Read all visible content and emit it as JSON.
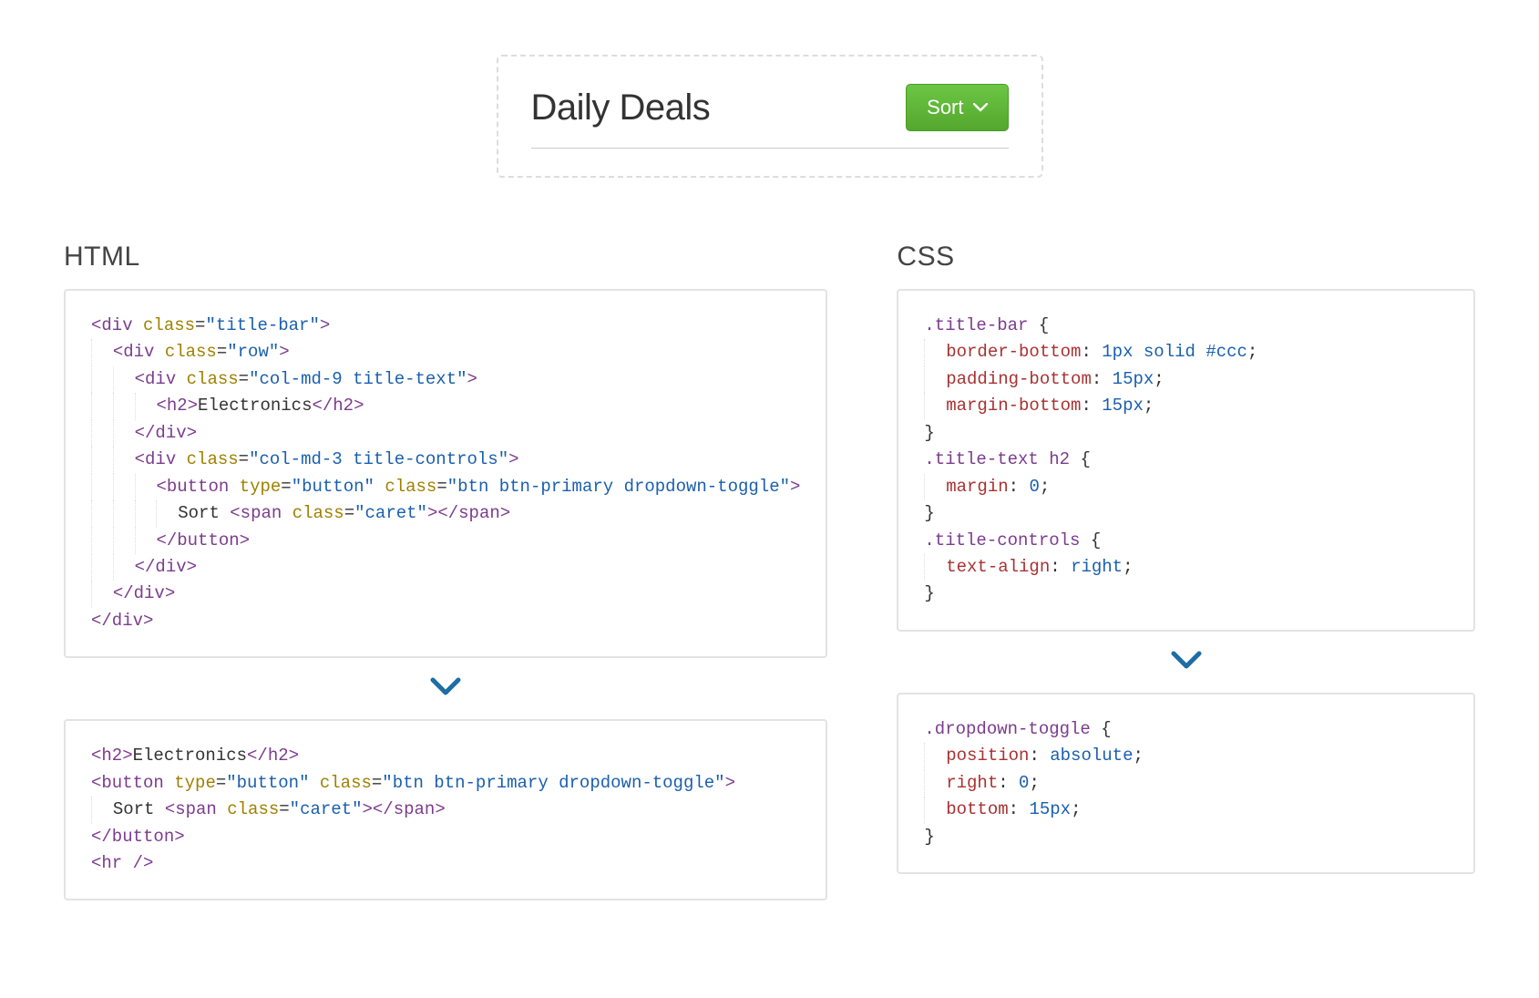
{
  "preview": {
    "title": "Daily Deals",
    "button_label": "Sort"
  },
  "columns": {
    "left_header": "HTML",
    "right_header": "CSS"
  },
  "code": {
    "html_top": [
      [
        {
          "t": "tag",
          "s": "<div"
        },
        {
          "t": "plain",
          "s": " "
        },
        {
          "t": "attr",
          "s": "class"
        },
        {
          "t": "plain",
          "s": "="
        },
        {
          "t": "str",
          "s": "\"title-bar\""
        },
        {
          "t": "tag",
          "s": ">"
        }
      ],
      [
        {
          "t": "indent",
          "n": 1
        },
        {
          "t": "tag",
          "s": "<div"
        },
        {
          "t": "plain",
          "s": " "
        },
        {
          "t": "attr",
          "s": "class"
        },
        {
          "t": "plain",
          "s": "="
        },
        {
          "t": "str",
          "s": "\"row\""
        },
        {
          "t": "tag",
          "s": ">"
        }
      ],
      [
        {
          "t": "indent",
          "n": 2
        },
        {
          "t": "tag",
          "s": "<div"
        },
        {
          "t": "plain",
          "s": " "
        },
        {
          "t": "attr",
          "s": "class"
        },
        {
          "t": "plain",
          "s": "="
        },
        {
          "t": "str",
          "s": "\"col-md-9 title-text\""
        },
        {
          "t": "tag",
          "s": ">"
        }
      ],
      [
        {
          "t": "indent",
          "n": 3
        },
        {
          "t": "tag",
          "s": "<h2>"
        },
        {
          "t": "plain",
          "s": "Electronics"
        },
        {
          "t": "tag",
          "s": "</h2>"
        }
      ],
      [
        {
          "t": "indent",
          "n": 2
        },
        {
          "t": "tag",
          "s": "</div>"
        }
      ],
      [
        {
          "t": "indent",
          "n": 2
        },
        {
          "t": "tag",
          "s": "<div"
        },
        {
          "t": "plain",
          "s": " "
        },
        {
          "t": "attr",
          "s": "class"
        },
        {
          "t": "plain",
          "s": "="
        },
        {
          "t": "str",
          "s": "\"col-md-3 title-controls\""
        },
        {
          "t": "tag",
          "s": ">"
        }
      ],
      [
        {
          "t": "indent",
          "n": 3
        },
        {
          "t": "tag",
          "s": "<button"
        },
        {
          "t": "plain",
          "s": " "
        },
        {
          "t": "attr",
          "s": "type"
        },
        {
          "t": "plain",
          "s": "="
        },
        {
          "t": "str",
          "s": "\"button\""
        },
        {
          "t": "plain",
          "s": " "
        },
        {
          "t": "attr",
          "s": "class"
        },
        {
          "t": "plain",
          "s": "="
        },
        {
          "t": "str",
          "s": "\"btn btn-primary dropdown-toggle\""
        },
        {
          "t": "tag",
          "s": ">"
        }
      ],
      [
        {
          "t": "indent",
          "n": 4
        },
        {
          "t": "plain",
          "s": "Sort "
        },
        {
          "t": "tag",
          "s": "<span"
        },
        {
          "t": "plain",
          "s": " "
        },
        {
          "t": "attr",
          "s": "class"
        },
        {
          "t": "plain",
          "s": "="
        },
        {
          "t": "str",
          "s": "\"caret\""
        },
        {
          "t": "tag",
          "s": "></span>"
        }
      ],
      [
        {
          "t": "indent",
          "n": 3
        },
        {
          "t": "tag",
          "s": "</button>"
        }
      ],
      [
        {
          "t": "indent",
          "n": 2
        },
        {
          "t": "tag",
          "s": "</div>"
        }
      ],
      [
        {
          "t": "indent",
          "n": 1
        },
        {
          "t": "tag",
          "s": "</div>"
        }
      ],
      [
        {
          "t": "tag",
          "s": "</div>"
        }
      ]
    ],
    "html_bottom": [
      [
        {
          "t": "tag",
          "s": "<h2>"
        },
        {
          "t": "plain",
          "s": "Electronics"
        },
        {
          "t": "tag",
          "s": "</h2>"
        }
      ],
      [
        {
          "t": "tag",
          "s": "<button"
        },
        {
          "t": "plain",
          "s": " "
        },
        {
          "t": "attr",
          "s": "type"
        },
        {
          "t": "plain",
          "s": "="
        },
        {
          "t": "str",
          "s": "\"button\""
        },
        {
          "t": "plain",
          "s": " "
        },
        {
          "t": "attr",
          "s": "class"
        },
        {
          "t": "plain",
          "s": "="
        },
        {
          "t": "str",
          "s": "\"btn btn-primary dropdown-toggle\""
        },
        {
          "t": "tag",
          "s": ">"
        }
      ],
      [
        {
          "t": "indent",
          "n": 1
        },
        {
          "t": "plain",
          "s": "Sort "
        },
        {
          "t": "tag",
          "s": "<span"
        },
        {
          "t": "plain",
          "s": " "
        },
        {
          "t": "attr",
          "s": "class"
        },
        {
          "t": "plain",
          "s": "="
        },
        {
          "t": "str",
          "s": "\"caret\""
        },
        {
          "t": "tag",
          "s": "></span>"
        }
      ],
      [
        {
          "t": "tag",
          "s": "</button>"
        }
      ],
      [
        {
          "t": "tag",
          "s": "<hr />"
        }
      ]
    ],
    "css_top": [
      [
        {
          "t": "sel",
          "s": ".title-bar"
        },
        {
          "t": "plain",
          "s": " "
        },
        {
          "t": "punct",
          "s": "{"
        }
      ],
      [
        {
          "t": "indent",
          "n": 1
        },
        {
          "t": "prop",
          "s": "border-bottom"
        },
        {
          "t": "punct",
          "s": ": "
        },
        {
          "t": "val",
          "s": "1px"
        },
        {
          "t": "plain",
          "s": " "
        },
        {
          "t": "val",
          "s": "solid"
        },
        {
          "t": "plain",
          "s": " "
        },
        {
          "t": "val",
          "s": "#ccc"
        },
        {
          "t": "punct",
          "s": ";"
        }
      ],
      [
        {
          "t": "indent",
          "n": 1
        },
        {
          "t": "prop",
          "s": "padding-bottom"
        },
        {
          "t": "punct",
          "s": ": "
        },
        {
          "t": "val",
          "s": "15px"
        },
        {
          "t": "punct",
          "s": ";"
        }
      ],
      [
        {
          "t": "indent",
          "n": 1
        },
        {
          "t": "prop",
          "s": "margin-bottom"
        },
        {
          "t": "punct",
          "s": ": "
        },
        {
          "t": "val",
          "s": "15px"
        },
        {
          "t": "punct",
          "s": ";"
        }
      ],
      [
        {
          "t": "punct",
          "s": "}"
        }
      ],
      [
        {
          "t": "sel",
          "s": ".title-text h2"
        },
        {
          "t": "plain",
          "s": " "
        },
        {
          "t": "punct",
          "s": "{"
        }
      ],
      [
        {
          "t": "indent",
          "n": 1
        },
        {
          "t": "prop",
          "s": "margin"
        },
        {
          "t": "punct",
          "s": ": "
        },
        {
          "t": "val",
          "s": "0"
        },
        {
          "t": "punct",
          "s": ";"
        }
      ],
      [
        {
          "t": "punct",
          "s": "}"
        }
      ],
      [
        {
          "t": "sel",
          "s": ".title-controls"
        },
        {
          "t": "plain",
          "s": " "
        },
        {
          "t": "punct",
          "s": "{"
        }
      ],
      [
        {
          "t": "indent",
          "n": 1
        },
        {
          "t": "prop",
          "s": "text-align"
        },
        {
          "t": "punct",
          "s": ": "
        },
        {
          "t": "val",
          "s": "right"
        },
        {
          "t": "punct",
          "s": ";"
        }
      ],
      [
        {
          "t": "punct",
          "s": "}"
        }
      ]
    ],
    "css_bottom": [
      [
        {
          "t": "sel",
          "s": ".dropdown-toggle"
        },
        {
          "t": "plain",
          "s": " "
        },
        {
          "t": "punct",
          "s": "{"
        }
      ],
      [
        {
          "t": "indent",
          "n": 1
        },
        {
          "t": "prop",
          "s": "position"
        },
        {
          "t": "punct",
          "s": ": "
        },
        {
          "t": "val",
          "s": "absolute"
        },
        {
          "t": "punct",
          "s": ";"
        }
      ],
      [
        {
          "t": "indent",
          "n": 1
        },
        {
          "t": "prop",
          "s": "right"
        },
        {
          "t": "punct",
          "s": ": "
        },
        {
          "t": "val",
          "s": "0"
        },
        {
          "t": "punct",
          "s": ";"
        }
      ],
      [
        {
          "t": "indent",
          "n": 1
        },
        {
          "t": "prop",
          "s": "bottom"
        },
        {
          "t": "punct",
          "s": ": "
        },
        {
          "t": "val",
          "s": "15px"
        },
        {
          "t": "punct",
          "s": ";"
        }
      ],
      [
        {
          "t": "punct",
          "s": "}"
        }
      ]
    ]
  }
}
